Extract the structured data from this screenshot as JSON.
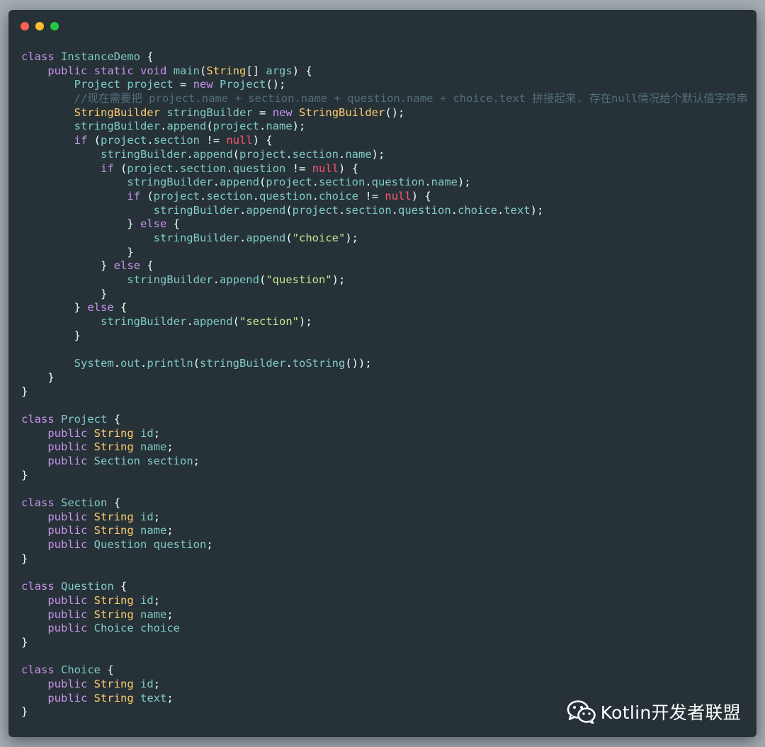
{
  "window": {
    "controls": [
      {
        "name": "close",
        "color": "#fe5f57"
      },
      {
        "name": "minimize",
        "color": "#febc2e"
      },
      {
        "name": "zoom",
        "color": "#28c840"
      }
    ]
  },
  "code": {
    "lines": [
      "class InstanceDemo {",
      "    public static void main(String[] args) {",
      "        Project project = new Project();",
      "        //现在需要把 project.name + section.name + question.name + choice.text 拼接起来. 存在null情况给个默认值字符串",
      "        StringBuilder stringBuilder = new StringBuilder();",
      "        stringBuilder.append(project.name);",
      "        if (project.section != null) {",
      "            stringBuilder.append(project.section.name);",
      "            if (project.section.question != null) {",
      "                stringBuilder.append(project.section.question.name);",
      "                if (project.section.question.choice != null) {",
      "                    stringBuilder.append(project.section.question.choice.text);",
      "                } else {",
      "                    stringBuilder.append(\"choice\");",
      "                }",
      "            } else {",
      "                stringBuilder.append(\"question\");",
      "            }",
      "        } else {",
      "            stringBuilder.append(\"section\");",
      "        }",
      "",
      "        System.out.println(stringBuilder.toString());",
      "    }",
      "}",
      "",
      "class Project {",
      "    public String id;",
      "    public String name;",
      "    public Section section;",
      "}",
      "",
      "class Section {",
      "    public String id;",
      "    public String name;",
      "    public Question question;",
      "}",
      "",
      "class Question {",
      "    public String id;",
      "    public String name;",
      "    public Choice choice",
      "}",
      "",
      "class Choice {",
      "    public String id;",
      "    public String text;",
      "}"
    ]
  },
  "watermark": {
    "icon": "wechat-icon",
    "text": "Kotlin开发者联盟"
  },
  "theme": {
    "background": "#263238",
    "keyword": "#c792ea",
    "type": "#ffcb6b",
    "string": "#c3e88d",
    "null": "#ff5370",
    "comment": "#546e7a",
    "plain": "#80cbc4",
    "identifier": "#eeffff"
  }
}
